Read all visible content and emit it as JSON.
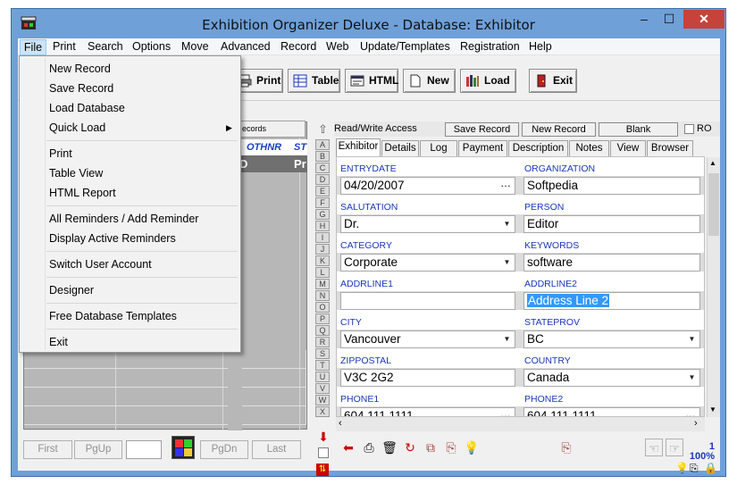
{
  "window": {
    "title": "Exhibition Organizer Deluxe - Database: Exhibitor",
    "minimize": "–",
    "maximize": "☐",
    "close": "✕"
  },
  "menubar": [
    "File",
    "Print",
    "Search",
    "Options",
    "Move",
    "Advanced",
    "Record",
    "Web",
    "Update/Templates",
    "Registration",
    "Help"
  ],
  "toolbar": {
    "print": "Print",
    "table": "Table",
    "html": "HTML",
    "new": "New",
    "load": "Load",
    "exit": "Exit"
  },
  "file_menu": {
    "items": [
      "New Record",
      "Save Record",
      "Load Database",
      "Quick Load",
      "Print",
      "Table View",
      "HTML Report",
      "All Reminders / Add Reminder",
      "Display Active Reminders",
      "Switch User Account",
      "Designer",
      "Free Database Templates",
      "Exit"
    ],
    "submenu_arrow": "▶"
  },
  "grid": {
    "records_label": "ecords",
    "col_header": "OTHNR",
    "col_header2": "ST",
    "row_header": "Pr",
    "row_header_left": "D"
  },
  "letters": [
    "A",
    "B",
    "C",
    "D",
    "E",
    "F",
    "G",
    "H",
    "I",
    "J",
    "K",
    "L",
    "M",
    "N",
    "O",
    "P",
    "Q",
    "R",
    "S",
    "T",
    "U",
    "V",
    "W",
    "X"
  ],
  "record_bar": {
    "label": "Read/Write Access",
    "save": "Save Record",
    "new": "New Record",
    "blank": "Blank",
    "ro": "RO"
  },
  "tabs": [
    "Exhibitor",
    "Details",
    "Log",
    "Payment",
    "Description",
    "Notes",
    "View",
    "Browser"
  ],
  "fields": {
    "entrydate": {
      "label": "ENTRYDATE",
      "value": "04/20/2007"
    },
    "organization": {
      "label": "ORGANIZATION",
      "value": "Softpedia"
    },
    "salutation": {
      "label": "SALUTATION",
      "value": "Dr."
    },
    "person": {
      "label": "PERSON",
      "value": "Editor"
    },
    "category": {
      "label": "CATEGORY",
      "value": "Corporate"
    },
    "keywords": {
      "label": "KEYWORDS",
      "value": "software"
    },
    "addrline1": {
      "label": "ADDRLINE1",
      "value": ""
    },
    "addrline2": {
      "label": "ADDRLINE2",
      "value": "Address Line 2"
    },
    "city": {
      "label": "CITY",
      "value": "Vancouver"
    },
    "stateprov": {
      "label": "STATEPROV",
      "value": "BC"
    },
    "zippostal": {
      "label": "ZIPPOSTAL",
      "value": "V3C 2G2"
    },
    "country": {
      "label": "COUNTRY",
      "value": "Canada"
    },
    "phone1": {
      "label": "PHONE1",
      "value": "604 111 1111"
    },
    "phone2": {
      "label": "PHONE2",
      "value": "604 111 1111"
    }
  },
  "nav": {
    "first": "First",
    "pgup": "PgUp",
    "pgdn": "PgDn",
    "last": "Last"
  },
  "record_count": {
    "index": "1",
    "zoom": "100%"
  },
  "colors": {
    "titlebar": "#6fa0d8",
    "close": "#c7423a",
    "label_blue": "#1a37b8",
    "selection": "#3399ff"
  }
}
